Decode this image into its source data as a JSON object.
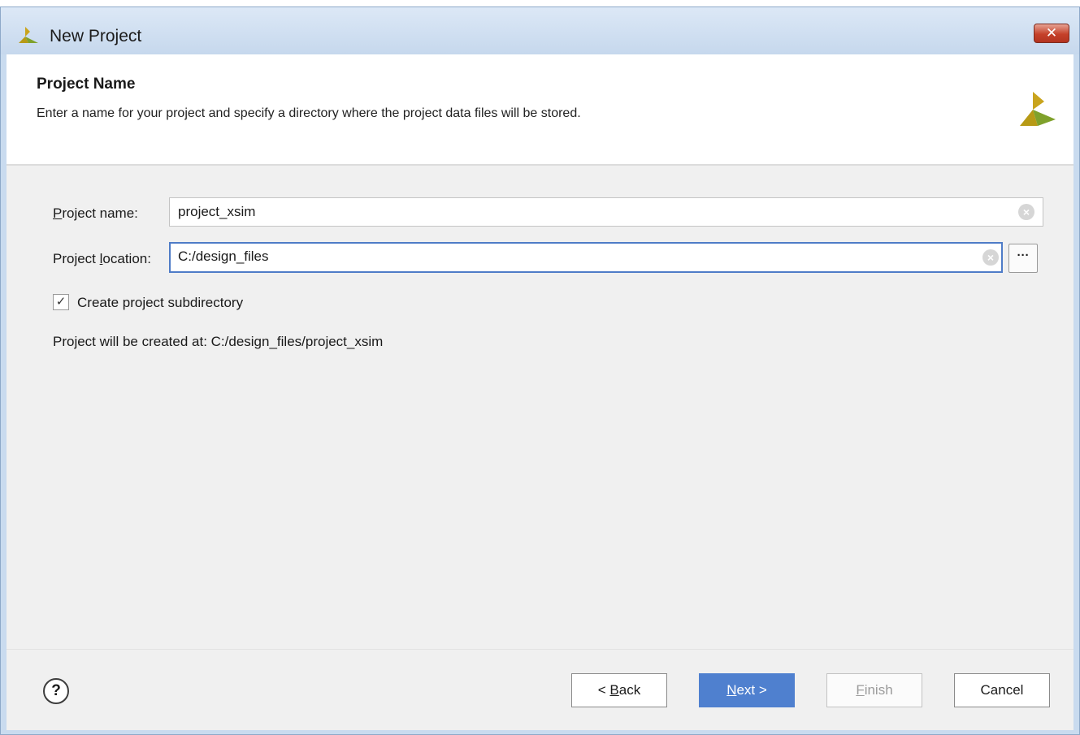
{
  "window": {
    "title": "New Project",
    "close_label": "✕"
  },
  "header": {
    "title": "Project Name",
    "description": "Enter a name for your project and specify a directory where the project data files will be stored."
  },
  "form": {
    "project_name": {
      "label_mnemonic": "P",
      "label_rest": "roject name:",
      "value": "project_xsim"
    },
    "project_location": {
      "label_prefix": "Project ",
      "label_mnemonic": "l",
      "label_rest": "ocation:",
      "value": "C:/design_files",
      "browse_label": "···"
    },
    "subdirectory": {
      "label": "Create project subdirectory",
      "checked": true,
      "check_glyph": "✓"
    },
    "created_at": "Project will be created at: C:/design_files/project_xsim"
  },
  "footer": {
    "help_glyph": "?",
    "back": {
      "prefix": "< ",
      "mnemonic": "B",
      "rest": "ack"
    },
    "next": {
      "mnemonic": "N",
      "rest": "ext >"
    },
    "finish": {
      "mnemonic": "F",
      "rest": "inish",
      "enabled": false
    },
    "cancel": "Cancel"
  },
  "colors": {
    "accent": "#4f80cf",
    "logo_gold": "#c0a21a",
    "logo_green": "#7e9e1c"
  },
  "icons": {
    "app_logo": "vivado-logo-icon",
    "clear": "clear-icon",
    "help": "help-icon"
  }
}
